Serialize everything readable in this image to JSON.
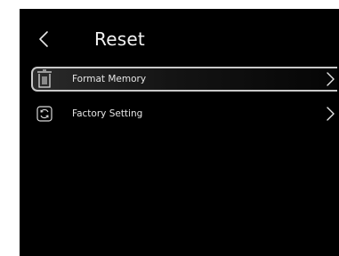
{
  "header": {
    "title": "Reset",
    "back_icon": "chevron-left-icon"
  },
  "menu": {
    "items": [
      {
        "label": "Format Memory",
        "icon": "trash-icon",
        "selected": true
      },
      {
        "label": "Factory Setting",
        "icon": "restore-icon",
        "selected": false
      }
    ]
  },
  "colors": {
    "background": "#000000",
    "text": "#e6e6e6",
    "selection_border": "#c9c9c9"
  }
}
